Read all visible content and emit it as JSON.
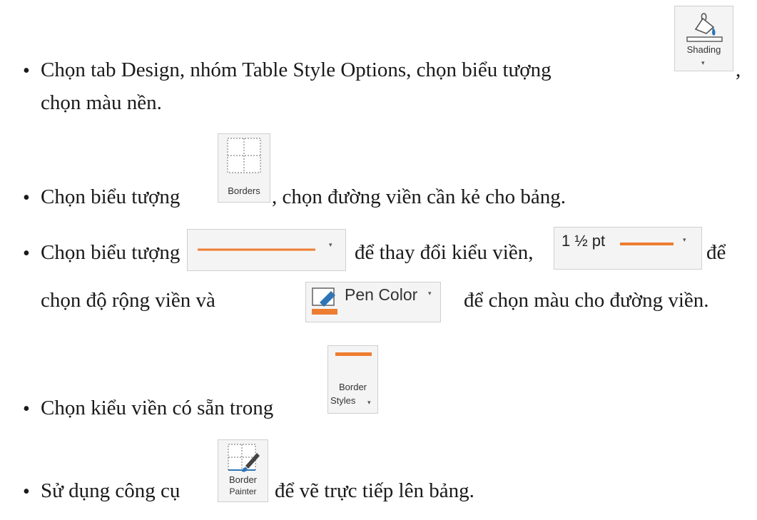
{
  "bullets": [
    {
      "mark": "•",
      "before": "Chọn tab Design, nhóm Table Style Options, chọn biểu tượng",
      "after": ",",
      "cont": "chọn màu nền."
    },
    {
      "mark": "•",
      "before": "Chọn biểu tượng",
      "after": ", chọn đường viền cần kẻ cho bảng."
    },
    {
      "mark": "•",
      "before": "Chọn biểu tượng",
      "mid1": "để thay đổi kiểu viền,",
      "mid2": "để",
      "cont_before": "chọn độ rộng viền và",
      "cont_after": "để chọn màu cho đường viền."
    },
    {
      "mark": "•",
      "before": "Chọn kiểu viền có sẵn trong"
    },
    {
      "mark": "•",
      "before": "Sử dụng công cụ",
      "after": "để vẽ trực tiếp lên bảng."
    }
  ],
  "icons": {
    "shading": {
      "label": "Shading",
      "caret": "▾",
      "accent": "#2e75b6"
    },
    "borders": {
      "label": "Borders"
    },
    "line_style": {
      "caret": "▾",
      "line_color": "#ed7d31"
    },
    "line_weight": {
      "text": "1 ½ pt",
      "caret": "▾",
      "line_color": "#ed7d31"
    },
    "pen_color": {
      "label": "Pen Color",
      "caret": "▾",
      "pen_color": "#ed7d31"
    },
    "border_styles": {
      "label_line1": "Border",
      "label_line2": "Styles",
      "caret": "▾",
      "line_color": "#ed7d31"
    },
    "border_painter": {
      "label_line1": "Border",
      "label_line2": "Painter"
    }
  }
}
